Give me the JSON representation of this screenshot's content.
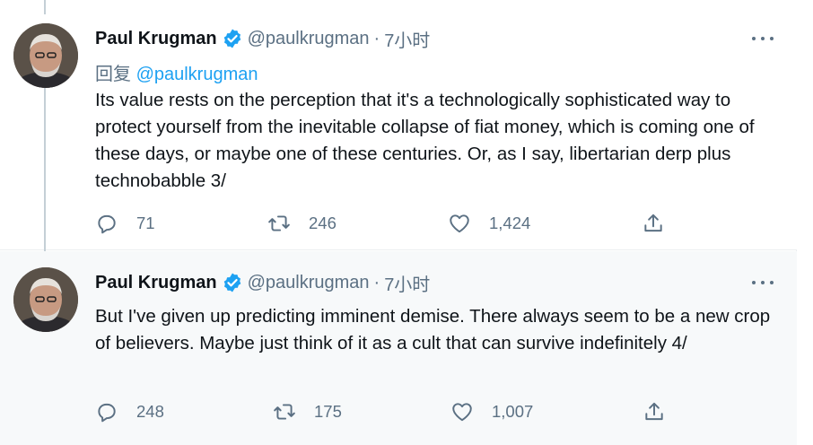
{
  "colors": {
    "accent": "#1da1f2",
    "verified": "#1da1f2",
    "muted": "#5b7083",
    "thread_line": "#c4cfd6"
  },
  "tweets": [
    {
      "author_name": "Paul Krugman",
      "verified_icon": "verified-badge-icon",
      "handle": "@paulkrugman",
      "separator": "·",
      "time": "7小时",
      "reply_prefix": "回复 ",
      "reply_mention": "@paulkrugman",
      "text": "Its value rests on the perception that it's a technologically sophisticated way to protect yourself from the inevitable collapse of fiat money, which is coming one of these days, or maybe one of these centuries. Or, as I say, libertarian derp plus technobabble 3/",
      "replies": "71",
      "retweets": "246",
      "likes": "1,424"
    },
    {
      "author_name": "Paul Krugman",
      "verified_icon": "verified-badge-icon",
      "handle": "@paulkrugman",
      "separator": "·",
      "time": "7小时",
      "text": "But I've given up predicting imminent demise. There always seem to be a new crop of believers. Maybe just think of it as a cult that can survive indefinitely 4/",
      "replies": "248",
      "retweets": "175",
      "likes": "1,007"
    }
  ]
}
